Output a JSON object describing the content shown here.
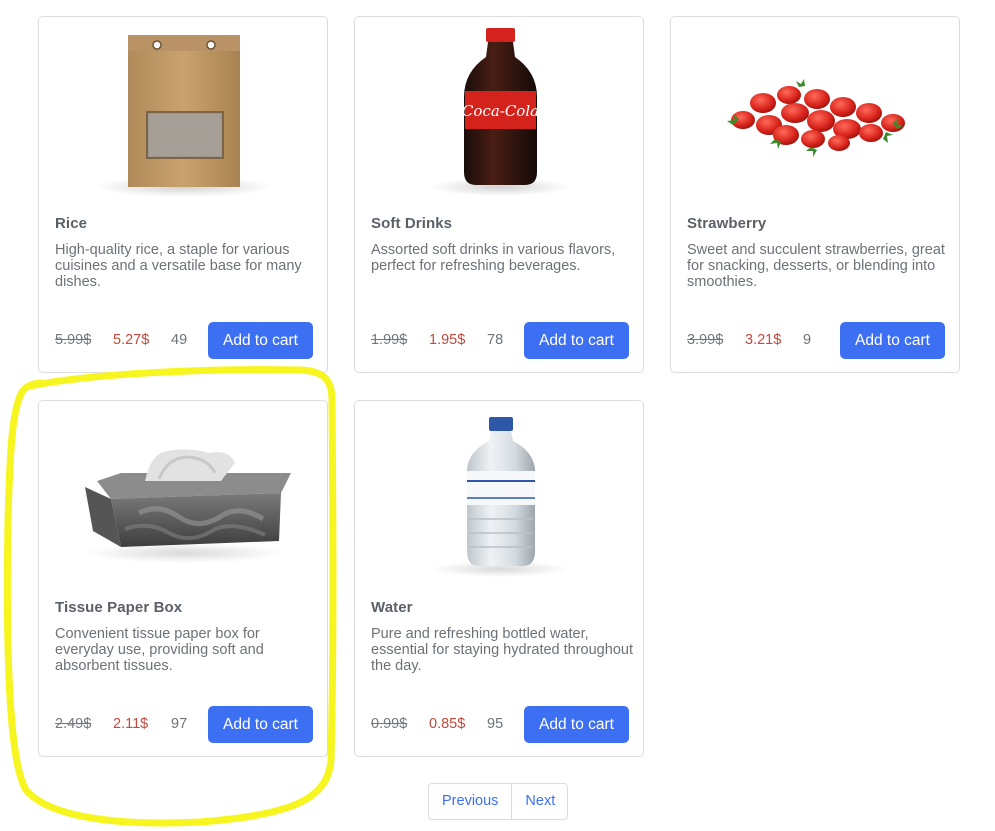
{
  "products": [
    {
      "name": "Rice",
      "description": "High-quality rice, a staple for various cuisines and a versatile base for many dishes.",
      "old_price": "5.99$",
      "new_price": "5.27$",
      "stock": "49",
      "button_label": "Add to cart",
      "image_icon": "rice-bag-icon"
    },
    {
      "name": "Soft Drinks",
      "description": "Assorted soft drinks in various flavors, perfect for refreshing beverages.",
      "old_price": "1.99$",
      "new_price": "1.95$",
      "stock": "78",
      "button_label": "Add to cart",
      "image_icon": "soda-bottle-icon",
      "image_text": "Coca-Cola"
    },
    {
      "name": "Strawberry",
      "description": "Sweet and succulent strawberries, great for snacking, desserts, or blending into smoothies.",
      "old_price": "3.99$",
      "new_price": "3.21$",
      "stock": "9",
      "button_label": "Add to cart",
      "image_icon": "strawberries-icon"
    },
    {
      "name": "Tissue Paper Box",
      "description": "Convenient tissue paper box for everyday use, providing soft and absorbent tissues.",
      "old_price": "2.49$",
      "new_price": "2.11$",
      "stock": "97",
      "button_label": "Add to cart",
      "image_icon": "tissue-box-icon"
    },
    {
      "name": "Water",
      "description": "Pure and refreshing bottled water, essential for staying hydrated throughout the day.",
      "old_price": "0.99$",
      "new_price": "0.85$",
      "stock": "95",
      "button_label": "Add to cart",
      "image_icon": "water-bottle-icon"
    }
  ],
  "pagination": {
    "previous_label": "Previous",
    "next_label": "Next"
  },
  "colors": {
    "accent": "#3d6ff2",
    "sale_price": "#c2493f",
    "highlight": "#f7f51f"
  }
}
